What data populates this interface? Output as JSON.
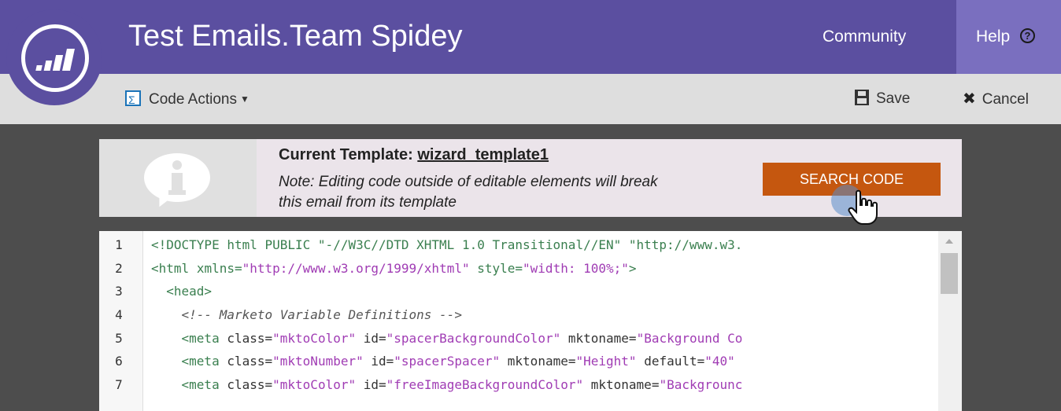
{
  "header": {
    "title": "Test Emails.Team Spidey",
    "nav_community": "Community",
    "nav_help": "Help",
    "help_icon": "?"
  },
  "toolbar": {
    "code_actions_label": "Code Actions",
    "save_label": "Save",
    "cancel_label": "Cancel"
  },
  "notice": {
    "title_prefix": "Current Template:",
    "template_name": "wizard_template1",
    "note_line1": "Note: Editing code outside of editable elements will break",
    "note_line2": "this email from its template",
    "search_button": "SEARCH CODE"
  },
  "editor": {
    "lines": [
      {
        "num": "1"
      },
      {
        "num": "2"
      },
      {
        "num": "3"
      },
      {
        "num": "4"
      },
      {
        "num": "5"
      },
      {
        "num": "6"
      },
      {
        "num": "7"
      }
    ],
    "code": {
      "l1": "<!DOCTYPE html PUBLIC \"-//W3C//DTD XHTML 1.0 Transitional//EN\" \"http://www.w3.",
      "l2_tag": "<html",
      "l2_attr1": "xmlns=",
      "l2_val1": "\"http://www.w3.org/1999/xhtml\"",
      "l2_attr2": "style=",
      "l2_val2": "\"width: 100%;\"",
      "l2_end": ">",
      "l3": "<head>",
      "l4": "<!-- Marketo Variable Definitions -->",
      "l5_tag": "<meta",
      "l5_a1": "class=",
      "l5_v1": "\"mktoColor\"",
      "l5_a2": "id=",
      "l5_v2": "\"spacerBackgroundColor\"",
      "l5_a3": "mktoname=",
      "l5_v3": "\"Background Co",
      "l6_tag": "<meta",
      "l6_a1": "class=",
      "l6_v1": "\"mktoNumber\"",
      "l6_a2": "id=",
      "l6_v2": "\"spacerSpacer\"",
      "l6_a3": "mktoname=",
      "l6_v3": "\"Height\"",
      "l6_a4": "default=",
      "l6_v4": "\"40\"",
      "l7_tag": "<meta",
      "l7_a1": "class=",
      "l7_v1": "\"mktoColor\"",
      "l7_a2": "id=",
      "l7_v2": "\"freeImageBackgroundColor\"",
      "l7_a3": "mktoname=",
      "l7_v3": "\"Backgrounc"
    }
  },
  "colors": {
    "header_bg": "#5b4fa0",
    "help_bg": "#7a6fbf",
    "toolbar_bg": "#dedede",
    "search_button_bg": "#c5570f",
    "page_bg": "#4d4d4d"
  },
  "icons": {
    "logo": "marketo-logo",
    "help": "question-circle-icon",
    "code_actions": "sigma-icon",
    "save": "floppy-disk-icon",
    "cancel": "x-icon",
    "info": "info-bubble-icon",
    "cursor": "hand-pointer-icon"
  }
}
